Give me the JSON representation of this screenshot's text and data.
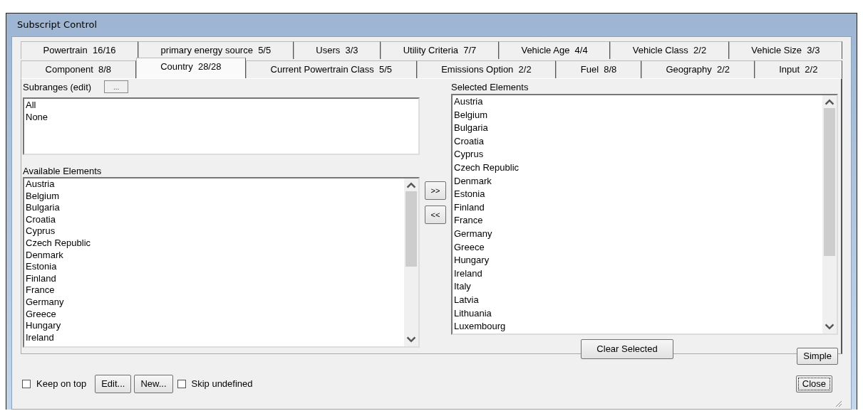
{
  "window": {
    "title": "Subscript Control"
  },
  "tab_rows": [
    [
      {
        "label": "Powertrain  16/16",
        "selected": false
      },
      {
        "label": "primary energy source  5/5",
        "selected": false
      },
      {
        "label": "Users  3/3",
        "selected": false
      },
      {
        "label": "Utility Criteria  7/7",
        "selected": false
      },
      {
        "label": "Vehicle Age  4/4",
        "selected": false
      },
      {
        "label": "Vehicle Class  2/2",
        "selected": false
      },
      {
        "label": "Vehicle Size  3/3",
        "selected": false
      }
    ],
    [
      {
        "label": "Component  8/8",
        "selected": false
      },
      {
        "label": "Country  28/28",
        "selected": true
      },
      {
        "label": "Current Powertrain Class  5/5",
        "selected": false
      },
      {
        "label": "Emissions Option  2/2",
        "selected": false
      },
      {
        "label": "Fuel  8/8",
        "selected": false
      },
      {
        "label": "Geography  2/2",
        "selected": false
      },
      {
        "label": "Input  2/2",
        "selected": false
      }
    ]
  ],
  "subranges": {
    "label": "Subranges (edit)",
    "button": "...",
    "items": [
      "All",
      "None"
    ]
  },
  "available": {
    "label": "Available Elements",
    "items": [
      "Austria",
      "Belgium",
      "Bulgaria",
      "Croatia",
      "Cyprus",
      "Czech Republic",
      "Denmark",
      "Estonia",
      "Finland",
      "France",
      "Germany",
      "Greece",
      "Hungary",
      "Ireland"
    ]
  },
  "move_buttons": [
    ">>",
    "<<"
  ],
  "selected_elements": {
    "label": "Selected Elements",
    "items": [
      "Austria",
      "Belgium",
      "Bulgaria",
      "Croatia",
      "Cyprus",
      "Czech Republic",
      "Denmark",
      "Estonia",
      "Finland",
      "France",
      "Germany",
      "Greece",
      "Hungary",
      "Ireland",
      "Italy",
      "Latvia",
      "Lithuania",
      "Luxembourg"
    ]
  },
  "clear_button": "Clear Selected",
  "simple_button": "Simple",
  "keep_on_top": {
    "label": "Keep on top",
    "checked": false
  },
  "edit_button": "Edit...",
  "new_button": "New...",
  "skip_undefined": {
    "label": "Skip undefined",
    "checked": false
  },
  "close_button": "Close"
}
